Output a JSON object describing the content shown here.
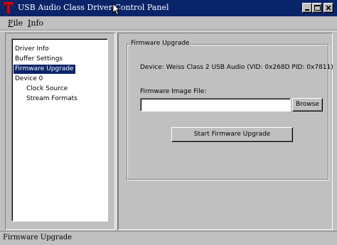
{
  "window": {
    "title": "USB Audio Class Driver Control Panel",
    "icon": "red-t-logo",
    "title_bar_color": "#0a246a"
  },
  "caption_buttons": {
    "minimize_icon": "minimize-icon",
    "maximize_icon": "maximize-icon",
    "close_icon": "close-icon"
  },
  "menu": {
    "items": [
      {
        "label": "File",
        "mnemonic": "F"
      },
      {
        "label": "Info",
        "mnemonic": "I"
      }
    ]
  },
  "tree": {
    "items": [
      {
        "label": "Driver Info",
        "level": 0,
        "selected": false
      },
      {
        "label": "Buffer Settings",
        "level": 0,
        "selected": false
      },
      {
        "label": "Firmware Upgrade",
        "level": 0,
        "selected": true
      },
      {
        "label": "Device 0",
        "level": 0,
        "selected": false
      },
      {
        "label": "Clock Source",
        "level": 1,
        "selected": false
      },
      {
        "label": "Stream Formats",
        "level": 1,
        "selected": false
      }
    ],
    "selection_color": "#0a246a"
  },
  "firmware": {
    "group_title": "Firmware Upgrade",
    "device_text": "Device: Weiss Class 2 USB Audio (VID: 0x268D PID: 0x7811)",
    "file_label": "Firmware Image File:",
    "file_value": "",
    "browse_label": "Browse",
    "start_label": "Start Firmware Upgrade"
  },
  "status": {
    "text": "Firmware Upgrade"
  }
}
